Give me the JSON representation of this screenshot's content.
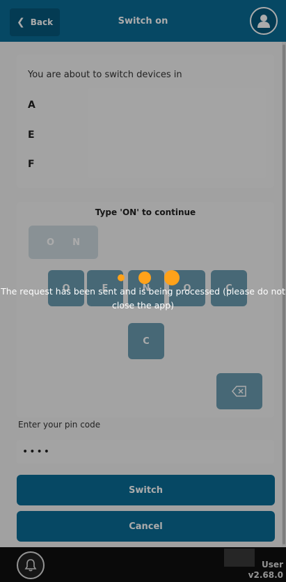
{
  "header": {
    "back_label": "Back",
    "title": "Switch on"
  },
  "devices": {
    "intro": "You are about to switch devices in",
    "items": [
      "A",
      "E",
      "F"
    ]
  },
  "keypad": {
    "title": "Type 'ON' to continue",
    "typed": [
      "O",
      "N"
    ],
    "row1": [
      "O",
      "E",
      "N",
      "O",
      "C"
    ],
    "row2": [
      "C"
    ]
  },
  "pin": {
    "label": "Enter your pin code",
    "value": "••••"
  },
  "actions": {
    "switch_label": "Switch",
    "cancel_label": "Cancel"
  },
  "footer": {
    "user": "User",
    "version": "v2.68.0"
  },
  "overlay": {
    "message": "The request has been sent and is being processed (please do not close the app)"
  },
  "colors": {
    "primary": "#0a6c96",
    "accent": "#ffa21a"
  }
}
